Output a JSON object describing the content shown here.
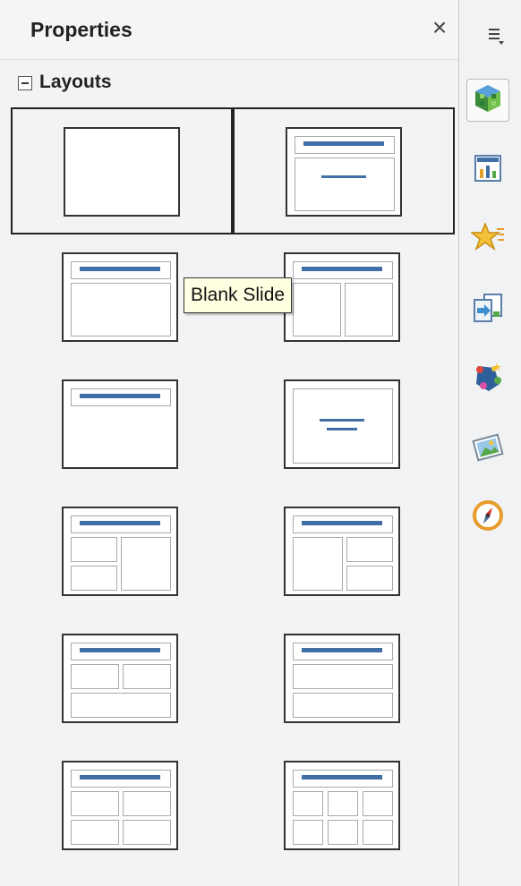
{
  "panel": {
    "title": "Properties",
    "close_glyph": "×",
    "section": {
      "collapse_glyph": "⊟",
      "label": "Layouts"
    },
    "layouts": [
      {
        "name": "blank",
        "selected": true
      },
      {
        "name": "title-content",
        "selected": true
      },
      {
        "name": "title-content-a"
      },
      {
        "name": "title-two-content"
      },
      {
        "name": "title-only"
      },
      {
        "name": "centered-text"
      },
      {
        "name": "title-2content-content"
      },
      {
        "name": "title-content-2content"
      },
      {
        "name": "title-2content-over-content"
      },
      {
        "name": "title-content-over-content"
      },
      {
        "name": "title-4content"
      },
      {
        "name": "title-6content"
      }
    ],
    "tooltip": "Blank Slide"
  },
  "tabbar": {
    "menu_icon": "sidebar-menu-icon",
    "tabs": [
      {
        "icon": "properties-cube-icon",
        "active": true
      },
      {
        "icon": "master-slides-icon"
      },
      {
        "icon": "custom-animation-star-icon"
      },
      {
        "icon": "slide-transition-icon"
      },
      {
        "icon": "styles-icon"
      },
      {
        "icon": "gallery-icon"
      },
      {
        "icon": "navigator-compass-icon"
      }
    ]
  },
  "colors": {
    "accent_bar": "#3f6fa4",
    "tooltip_bg": "#ffffe1"
  }
}
